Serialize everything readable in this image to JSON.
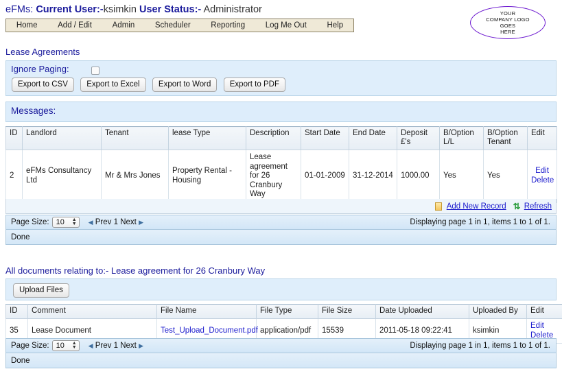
{
  "header": {
    "app_name": "eFMs:",
    "current_user_label": "Current User:-",
    "current_user": "ksimkin",
    "user_status_label": "User Status:-",
    "user_status": "Administrator",
    "nav": [
      {
        "label": "Home"
      },
      {
        "label": "Add / Edit"
      },
      {
        "label": "Admin"
      },
      {
        "label": "Scheduler"
      },
      {
        "label": "Reporting"
      },
      {
        "label": "Log Me Out"
      },
      {
        "label": "Help"
      }
    ],
    "logo_lines": [
      "YOUR",
      "COMPANY LOGO",
      "GOES",
      "HERE"
    ],
    "logo_border_color": "#6a15cf"
  },
  "lease_section": {
    "title": "Lease Agreements",
    "ignore_paging_label": "Ignore Paging:",
    "ignore_paging_checked": false,
    "export_buttons": [
      {
        "label": "Export to CSV"
      },
      {
        "label": "Export to Excel"
      },
      {
        "label": "Export to Word"
      },
      {
        "label": "Export to PDF"
      }
    ],
    "messages_label": "Messages:",
    "columns": [
      "ID",
      "Landlord",
      "Tenant",
      "lease Type",
      "Description",
      "Start Date",
      "End Date",
      "Deposit £'s",
      "B/Option L/L",
      "B/Option Tenant",
      "Edit"
    ],
    "rows": [
      {
        "id": "2",
        "landlord": "eFMs Consultancy Ltd",
        "tenant": "Mr & Mrs Jones",
        "lease_type": "Property Rental - Housing",
        "description": "Lease agreement for 26 Cranbury Way",
        "start_date": "01-01-2009",
        "end_date": "31-12-2014",
        "deposit": "1000.00",
        "boption_ll": "Yes",
        "boption_tenant": "Yes",
        "edit_label": "Edit",
        "delete_label": "Delete"
      }
    ],
    "commands": {
      "add_new_record": "Add New Record",
      "refresh": "Refresh"
    },
    "paging": {
      "page_size_label": "Page Size:",
      "page_size_value": "10",
      "prev_label": "Prev",
      "page_number": "1",
      "next_label": "Next",
      "display_info": "Displaying page 1 in 1, items 1 to 1 of 1."
    },
    "status": "Done"
  },
  "documents_section": {
    "title": "All documents relating to:- Lease agreement for 26 Cranbury Way",
    "upload_button": "Upload Files",
    "columns": [
      "ID",
      "Comment",
      "File Name",
      "File Type",
      "File Size",
      "Date Uploaded",
      "Uploaded By",
      "Edit"
    ],
    "rows": [
      {
        "id": "35",
        "comment": "Lease Document",
        "file_name": "Test_Upload_Document.pdf",
        "file_type": "application/pdf",
        "file_size": "15539",
        "date_uploaded": "2011-05-18 09:22:41",
        "uploaded_by": "ksimkin",
        "edit_label": "Edit",
        "delete_label": "Delete"
      }
    ],
    "paging": {
      "page_size_label": "Page Size:",
      "page_size_value": "10",
      "prev_label": "Prev",
      "page_number": "1",
      "next_label": "Next",
      "display_info": "Displaying page 1 in 1, items 1 to 1 of 1."
    },
    "status": "Done"
  }
}
